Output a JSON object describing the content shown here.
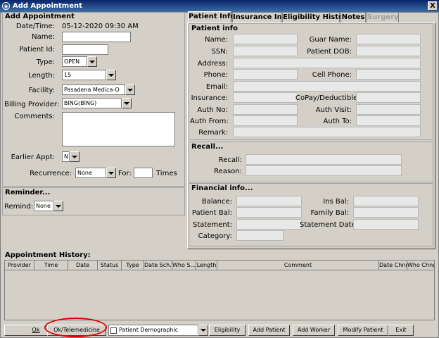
{
  "window": {
    "title": "Add Appointment",
    "close_glyph": "X"
  },
  "appointment": {
    "section_title": "Add Appointment",
    "datetime_label": "Date/Time:",
    "datetime_value": "05-12-2020 09:30 AM",
    "name_label": "Name:",
    "patient_id_label": "Patient Id:",
    "type_label": "Type:",
    "type_value": "OPEN",
    "length_label": "Length:",
    "length_value": "15",
    "facility_label": "Facility:",
    "facility_value": "Pasadena Medica-O",
    "billing_label": "Billing Provider:",
    "billing_value": "BING(BING)",
    "comments_label": "Comments:",
    "earlier_label": "Earlier Appt:",
    "earlier_value": "N",
    "recurrence_label": "Recurrence:",
    "recurrence_value": "None",
    "for_label": "For:",
    "times_label": "Times"
  },
  "reminder": {
    "section_title": "Reminder...",
    "remind_label": "Remind:",
    "remind_value": "None"
  },
  "tabs": [
    {
      "label": "Patient Info"
    },
    {
      "label": "Insurance Info"
    },
    {
      "label": "Eligibility History"
    },
    {
      "label": "Notes"
    },
    {
      "label": "Surgery"
    }
  ],
  "patient_info": {
    "section_title": "Patient info",
    "name": "Name:",
    "guar_name": "Guar Name:",
    "ssn": "SSN:",
    "dob": "Patient DOB:",
    "address": "Address:",
    "phone": "Phone:",
    "cell": "Cell Phone:",
    "email": "Email:",
    "insurance": "Insurance:",
    "copay": "CoPay/Deductible:",
    "auth_no": "Auth No:",
    "auth_visit": "Auth Visit:",
    "auth_from": "Auth From:",
    "auth_to": "Auth To:",
    "remark": "Remark:"
  },
  "recall": {
    "section_title": "Recall...",
    "recall": "Recall:",
    "reason": "Reason:"
  },
  "financial": {
    "section_title": "Financial info...",
    "balance": "Balance:",
    "ins_bal": "Ins Bal:",
    "patient_bal": "Patient Bal:",
    "family_bal": "Family Bal:",
    "statement": "Statement:",
    "statement_date": "Statement Date:",
    "category": "Category:"
  },
  "history": {
    "section_title": "Appointment History:",
    "columns": [
      "Provider",
      "Time",
      "Date",
      "Status",
      "Type",
      "Date Sch...",
      "Who S...",
      "Length",
      "Comment",
      "Date Chng",
      "Who Chng"
    ]
  },
  "buttons": {
    "ok": "Ok",
    "ok_telemedicine": "Ok/Telemedicine",
    "patient_demographic": "Patient Demographic",
    "eligibility": "Eligibility",
    "add_patient": "Add Patient",
    "add_worker": "Add Worker",
    "modify_patient": "Modify Patient",
    "exit": "Exit"
  },
  "colors": {
    "highlight_ring": "#e00000",
    "title_bar": "#0a246a"
  }
}
